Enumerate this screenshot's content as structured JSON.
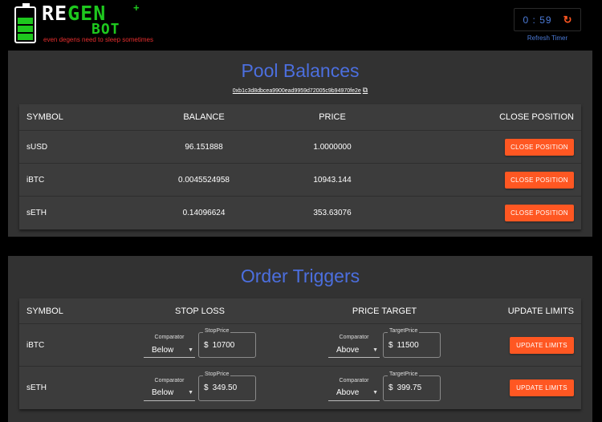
{
  "brand": {
    "name_white": "RE",
    "name_green": "GEN",
    "plus": "+",
    "bot": "BOT",
    "tagline": "even degens need to sleep sometimes"
  },
  "timer": {
    "value": "0 : 59",
    "label": "Refresh Timer",
    "icon": "refresh-icon"
  },
  "pool": {
    "title": "Pool Balances",
    "address": "0xb1c3d8dbcea9900ead9959d72005c9b94970fe2e",
    "columns": [
      "SYMBOL",
      "BALANCE",
      "PRICE",
      "CLOSE POSITION"
    ],
    "rows": [
      {
        "symbol": "sUSD",
        "balance": "96.151888",
        "price": "1.0000000",
        "action": "CLOSE POSITION"
      },
      {
        "symbol": "iBTC",
        "balance": "0.0045524958",
        "price": "10943.144",
        "action": "CLOSE POSITION"
      },
      {
        "symbol": "sETH",
        "balance": "0.14096624",
        "price": "353.63076",
        "action": "CLOSE POSITION"
      }
    ]
  },
  "triggers": {
    "title": "Order Triggers",
    "columns": [
      "SYMBOL",
      "STOP LOSS",
      "PRICE TARGET",
      "UPDATE LIMITS"
    ],
    "comparator_label": "Comparator",
    "stop_label": "StopPrice",
    "target_label": "TargetPrice",
    "currency": "$",
    "rows": [
      {
        "symbol": "iBTC",
        "stop_cmp": "Below",
        "stop_price": "10700",
        "target_cmp": "Above",
        "target_price": "11500",
        "action": "UPDATE LIMITS"
      },
      {
        "symbol": "sETH",
        "stop_cmp": "Below",
        "stop_price": "349.50",
        "target_cmp": "Above",
        "target_price": "399.75",
        "action": "UPDATE LIMITS"
      }
    ]
  },
  "colors": {
    "accent": "#ff5722",
    "title": "#4c6fdf",
    "brand_green": "#1ec81e",
    "tagline": "#e62e2e"
  }
}
